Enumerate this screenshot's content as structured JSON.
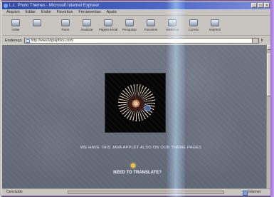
{
  "window": {
    "title": "L.L. Photo Themes - Microsoft Internet Explorer"
  },
  "menu": [
    "Arquivo",
    "Editar",
    "Exibir",
    "Favoritos",
    "Ferramentas",
    "Ajuda"
  ],
  "toolbar": [
    {
      "label": "Voltar",
      "icon": "back-icon"
    },
    {
      "label": "",
      "icon": "forward-icon"
    },
    {
      "label": "Parar",
      "icon": "stop-icon"
    },
    {
      "label": "Atualizar",
      "icon": "refresh-icon"
    },
    {
      "label": "Página inicial",
      "icon": "home-icon"
    },
    {
      "label": "Pesquisar",
      "icon": "search-icon"
    },
    {
      "label": "Favoritos",
      "icon": "favorites-icon"
    },
    {
      "label": "Histórico",
      "icon": "history-icon"
    },
    {
      "label": "Correio",
      "icon": "mail-icon"
    },
    {
      "label": "Imprimir",
      "icon": "print-icon"
    }
  ],
  "address": {
    "label": "Endereço",
    "url": "http://www.ldgraphics.com/",
    "go": "Ir"
  },
  "page": {
    "caption": "WE HAVE THIS JAVA APPLET ALSO ON OUR THEME PAGES",
    "translate": "NEED TO TRANSLATE?"
  },
  "status": {
    "left": "Concluído",
    "right": "Internet"
  }
}
